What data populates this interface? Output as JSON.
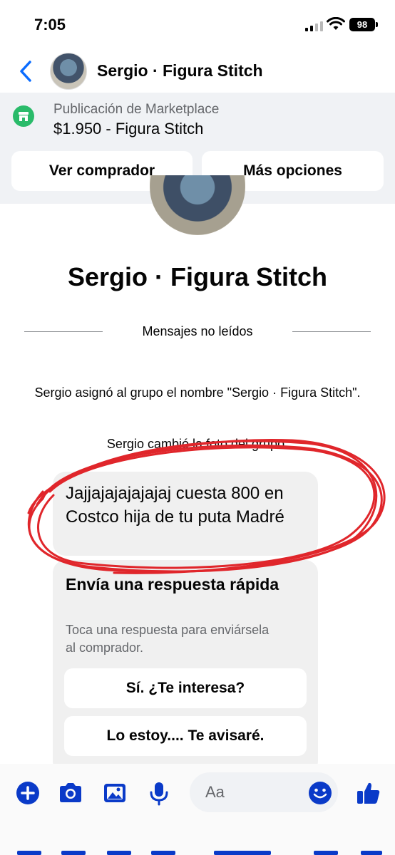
{
  "status_bar": {
    "time": "7:05",
    "battery": "98"
  },
  "header": {
    "title": "Sergio · Figura Stitch"
  },
  "marketplace": {
    "kicker": "Publicación de Marketplace",
    "listing": "$1.950 - Figura Stitch",
    "buttons": {
      "view_buyer": "Ver comprador",
      "more_options": "Más opciones"
    }
  },
  "profile": {
    "name": "Sergio · Figura Stitch"
  },
  "unread_divider": "Mensajes no leídos",
  "system_messages": [
    "Sergio asignó al grupo el nombre \"Sergio · Figura Stitch\".",
    "Sergio cambió la foto del grupo."
  ],
  "message": {
    "text": "Jajjajajajajajaj cuesta 800 en Costco hija de tu puta Madré"
  },
  "quick_reply": {
    "title": "Envía una respuesta rápida",
    "subtitle": "Toca una respuesta para enviársela al comprador.",
    "options": [
      "Sí. ¿Te interesa?",
      "Lo estoy.... Te avisaré."
    ]
  },
  "composer": {
    "placeholder": "Aa"
  },
  "colors": {
    "accent": "#0a3ac8",
    "marketplace_green": "#2abb6a",
    "annotation_red": "#e0262b"
  },
  "icons": [
    "back-chevron-icon",
    "marketplace-shop-icon",
    "plus-icon",
    "camera-icon",
    "gallery-icon",
    "microphone-icon",
    "emoji-icon",
    "thumbs-up-icon"
  ]
}
